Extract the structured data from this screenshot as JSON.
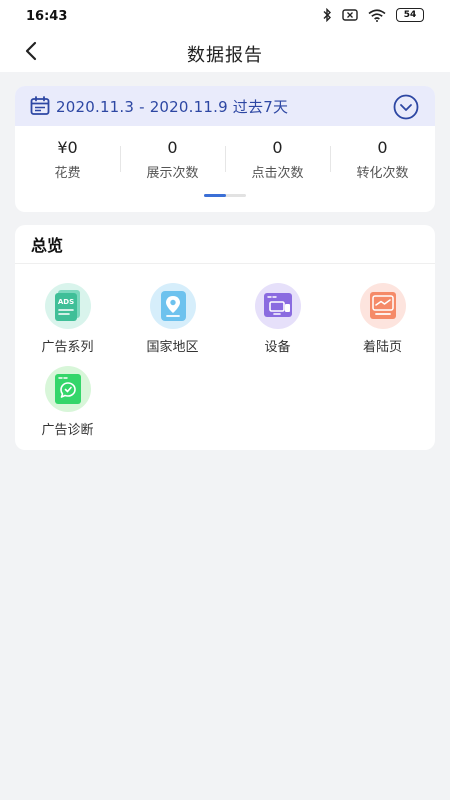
{
  "status_bar": {
    "time": "16:43",
    "battery": "54",
    "icons": [
      "bluetooth-icon",
      "no-sim-icon",
      "wifi-icon",
      "battery-icon"
    ]
  },
  "header": {
    "title": "数据报告",
    "back_icon": "back-arrow-icon"
  },
  "date_filter": {
    "range_text": "2020.11.3 - 2020.11.9 过去7天",
    "icon": "calendar-icon",
    "dropdown_icon": "chevron-down-circle-icon"
  },
  "metrics": [
    {
      "value": "¥0",
      "label": "花费"
    },
    {
      "value": "0",
      "label": "展示次数"
    },
    {
      "value": "0",
      "label": "点击次数"
    },
    {
      "value": "0",
      "label": "转化次数"
    }
  ],
  "overview": {
    "title": "总览",
    "items": [
      {
        "label": "广告系列",
        "icon": "ads-document-icon",
        "icon_text": "ADS"
      },
      {
        "label": "国家地区",
        "icon": "location-pin-icon"
      },
      {
        "label": "设备",
        "icon": "devices-icon"
      },
      {
        "label": "着陆页",
        "icon": "landing-page-icon"
      },
      {
        "label": "广告诊断",
        "icon": "diagnosis-chat-icon"
      }
    ]
  },
  "colors": {
    "accent": "#2d47a3",
    "date_bar_bg": "#e9ebfb",
    "page_bg": "#f2f3f5",
    "indicator_active": "#3b6fd6"
  }
}
